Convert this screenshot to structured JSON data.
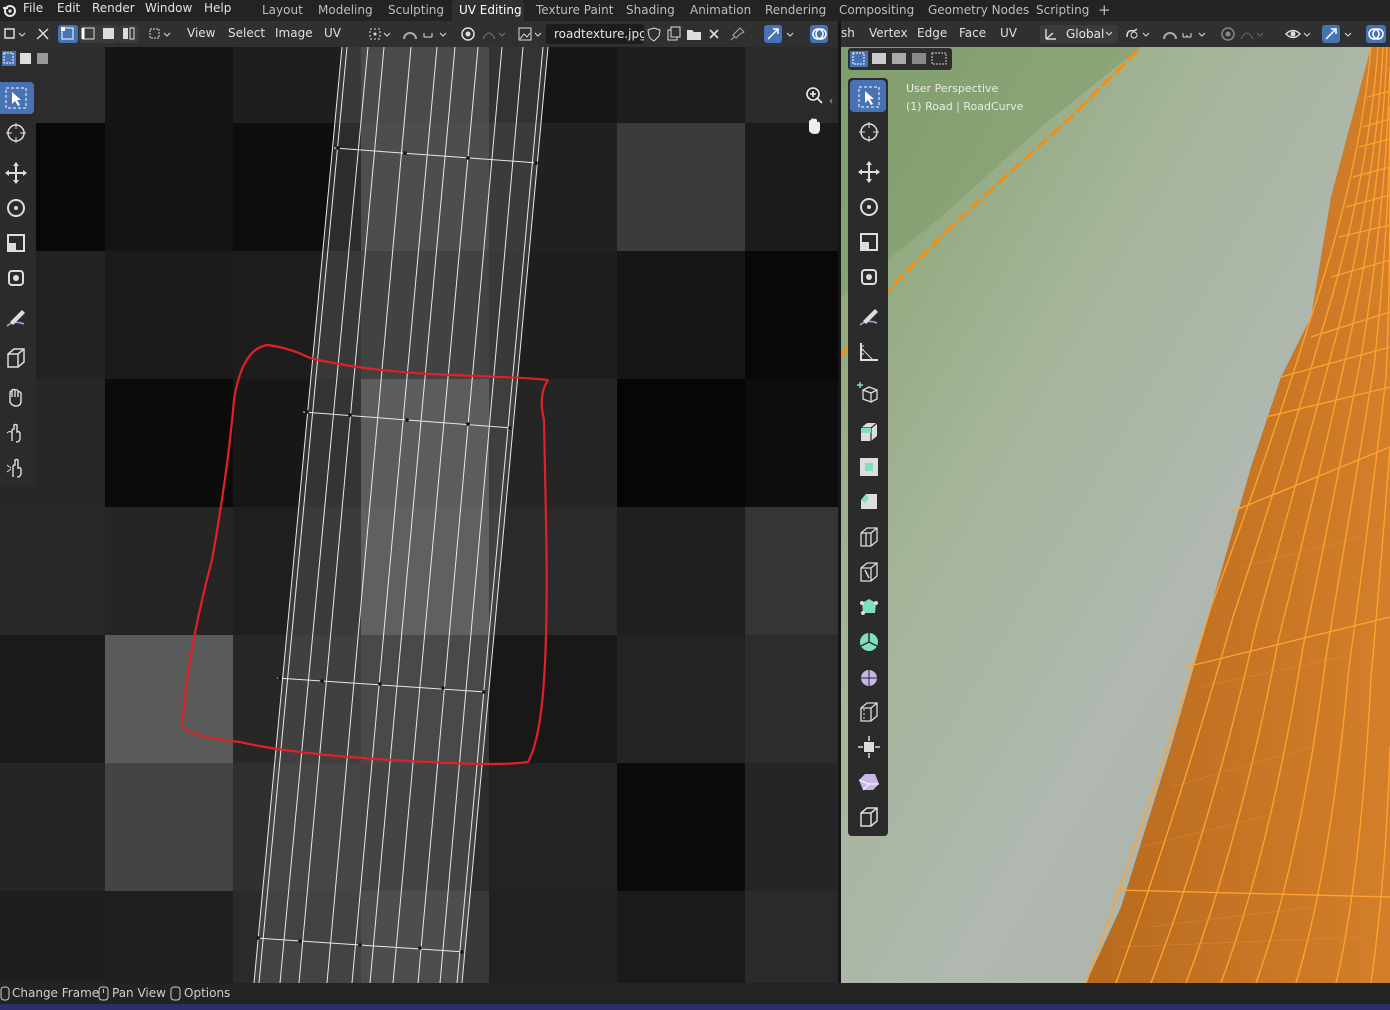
{
  "menus": [
    "File",
    "Edit",
    "Render",
    "Window",
    "Help"
  ],
  "workspaces": [
    "Layout",
    "Modeling",
    "Sculpting",
    "UV Editing",
    "Texture Paint",
    "Shading",
    "Animation",
    "Rendering",
    "Compositing",
    "Geometry Nodes",
    "Scripting"
  ],
  "active_workspace": "UV Editing",
  "uv_header": {
    "view": "View",
    "select": "Select",
    "image": "Image",
    "uv": "UV",
    "image_name": "roadtexture.jpg"
  },
  "viewport_header": {
    "mesh_fragment": "sh",
    "vertex": "Vertex",
    "edge": "Edge",
    "face": "Face",
    "uv": "UV",
    "orientation": "Global"
  },
  "viewport_overlay": {
    "perspective": "User Perspective",
    "object": "(1) Road | RoadCurve"
  },
  "status_bar": {
    "change_frame": "Change Frame",
    "pan_view": "Pan View",
    "options": "Options"
  },
  "colors": {
    "selection_orange": "#ff8a00",
    "annotation_red": "#e0202a",
    "active_blue": "#4772b3"
  }
}
